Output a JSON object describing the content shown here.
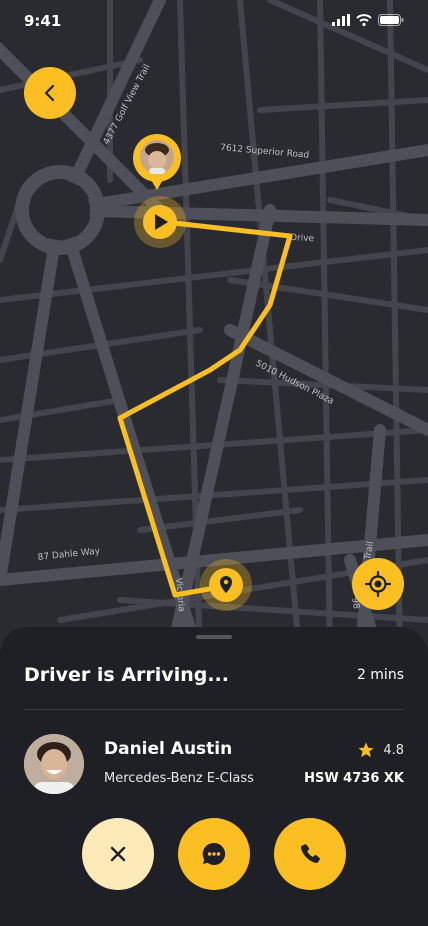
{
  "status_bar": {
    "time": "9:41"
  },
  "map": {
    "streets": {
      "golf_view": "4377 Golf View Trail",
      "superior": "7612 Superior Road",
      "drive": "Drive",
      "hudson": "5010 Hudson Plaza",
      "dahle": "87 Dahle Way",
      "victoria": "Victoria",
      "trail": "Trail",
      "num98": "98"
    },
    "route_color": "#fbbf24"
  },
  "sheet": {
    "title": "Driver is Arriving...",
    "eta": "2 mins",
    "driver": {
      "name": "Daniel Austin",
      "car": "Mercedes-Benz E-Class",
      "rating": "4.8",
      "plate": "HSW 4736 XK"
    }
  },
  "actions": {
    "cancel_icon": "close-icon",
    "chat_icon": "chat-bubble-icon",
    "call_icon": "phone-icon"
  },
  "colors": {
    "accent": "#fbbf24",
    "accent_light": "#fdeab9",
    "sheet_bg": "#1f2025",
    "map_bg": "#2a2b31"
  }
}
